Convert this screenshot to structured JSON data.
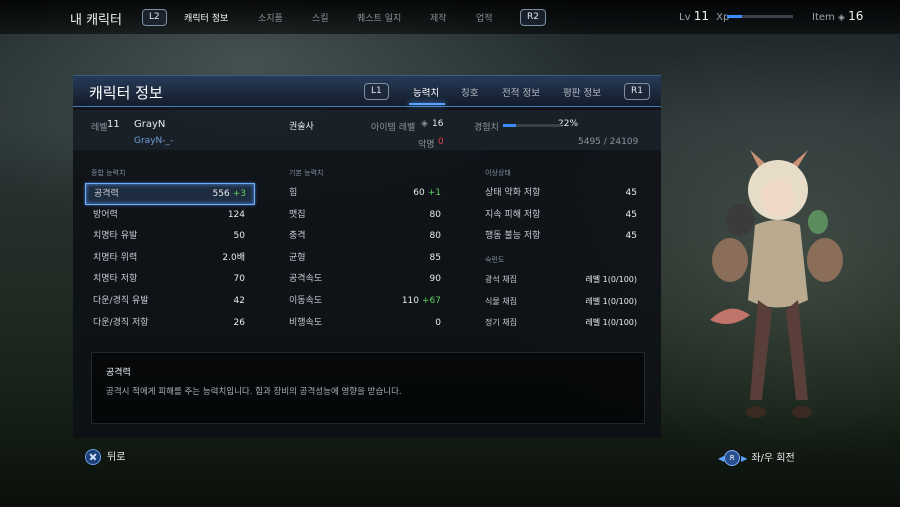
{
  "topbar": {
    "title": "내 캐릭터",
    "l2": "L2",
    "r2": "R2",
    "nav": [
      "캐릭터 정보",
      "소지품",
      "스킬",
      "퀘스트 일지",
      "제작",
      "업적"
    ],
    "level_label": "Lv",
    "level_value": "11",
    "xp_label": "Xp",
    "xp_progress": 0.22,
    "item_label": "Item",
    "item_value": "16"
  },
  "panel": {
    "title": "캐릭터 정보",
    "l1": "L1",
    "r1": "R1",
    "tabs": [
      "능력치",
      "칭호",
      "전적 정보",
      "평판 정보"
    ]
  },
  "info": {
    "level_label": "레벨",
    "level": "11",
    "name": "GrayN",
    "guild": "GrayN-_-",
    "class": "권술사",
    "item_level_label": "아이템 레벨",
    "item_level": "16",
    "infamy_label": "악명",
    "infamy": "0",
    "exp_label": "경험치",
    "exp_percent": "22%",
    "exp_progress": 0.22,
    "exp_numbers": "5495 / 24109"
  },
  "combined": {
    "title": "종합 능력치",
    "rows": [
      {
        "label": "공격력",
        "value": "556",
        "bonus": "+3"
      },
      {
        "label": "방어력",
        "value": "124",
        "bonus": ""
      },
      {
        "label": "치명타 유발",
        "value": "50",
        "bonus": ""
      },
      {
        "label": "치명타 위력",
        "value": "2.0배",
        "bonus": ""
      },
      {
        "label": "치명타 저항",
        "value": "70",
        "bonus": ""
      },
      {
        "label": "다운/경직 유발",
        "value": "42",
        "bonus": ""
      },
      {
        "label": "다운/경직 저항",
        "value": "26",
        "bonus": ""
      }
    ]
  },
  "basic": {
    "title": "기본 능력치",
    "rows": [
      {
        "label": "힘",
        "value": "60",
        "bonus": "+1"
      },
      {
        "label": "맷집",
        "value": "80",
        "bonus": ""
      },
      {
        "label": "충격",
        "value": "80",
        "bonus": ""
      },
      {
        "label": "균형",
        "value": "85",
        "bonus": ""
      },
      {
        "label": "공격속도",
        "value": "90",
        "bonus": ""
      },
      {
        "label": "이동속도",
        "value": "110",
        "bonus": "+67"
      },
      {
        "label": "비행속도",
        "value": "0",
        "bonus": ""
      }
    ]
  },
  "status": {
    "title": "이상상태",
    "rows": [
      {
        "label": "상태 약화 저항",
        "value": "45"
      },
      {
        "label": "지속 피해 저항",
        "value": "45"
      },
      {
        "label": "행동 불능 저항",
        "value": "45"
      }
    ]
  },
  "proficiency": {
    "title": "숙련도",
    "rows": [
      {
        "label": "광석 채집",
        "value": "레벨 1(0/100)"
      },
      {
        "label": "식물 채집",
        "value": "레벨 1(0/100)"
      },
      {
        "label": "정기 채집",
        "value": "레벨 1(0/100)"
      }
    ]
  },
  "description": {
    "title": "공격력",
    "text": "공격시 적에게 피해를 주는 능력치입니다. 힘과 장비의 공격성능에 영향을 받습니다."
  },
  "footer": {
    "back_label": "뒤로",
    "rotate_button": "R",
    "rotate_label": "좌/우 회전"
  },
  "colors": {
    "accent": "#5aa2ff",
    "bonus": "#5fd25f",
    "infamy": "#e04040",
    "guild": "#6f9fd8"
  }
}
